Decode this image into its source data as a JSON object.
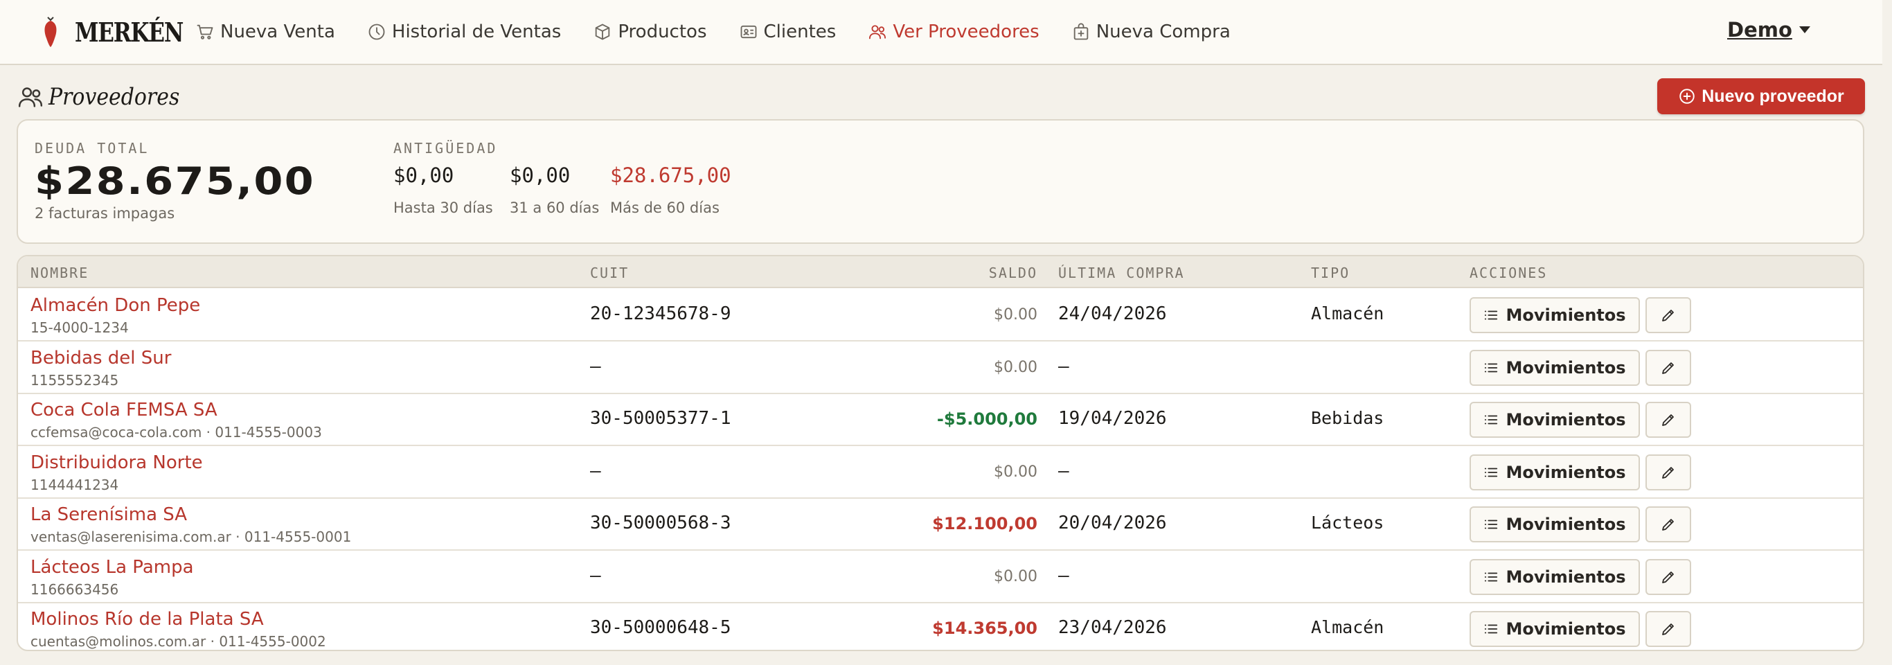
{
  "brand": {
    "name": "MERKÉN"
  },
  "nav": {
    "items": [
      {
        "label": "Nueva Venta",
        "icon": "cart-icon"
      },
      {
        "label": "Historial de Ventas",
        "icon": "clock-icon"
      },
      {
        "label": "Productos",
        "icon": "box-icon"
      },
      {
        "label": "Clientes",
        "icon": "id-card-icon"
      },
      {
        "label": "Ver Proveedores",
        "icon": "users-icon",
        "active": true
      },
      {
        "label": "Nueva Compra",
        "icon": "bag-plus-icon"
      }
    ],
    "user": "Demo"
  },
  "page": {
    "title": "Proveedores",
    "new_button": "Nuevo proveedor"
  },
  "summary": {
    "debt_label": "DEUDA TOTAL",
    "debt_total": "$28.675,00",
    "debt_sub": "2 facturas impagas",
    "age_label": "ANTIGÜEDAD",
    "age": [
      {
        "value": "$0,00",
        "sub": "Hasta 30 días"
      },
      {
        "value": "$0,00",
        "sub": "31 a 60 días"
      },
      {
        "value": "$28.675,00",
        "sub": "Más de 60 días"
      }
    ]
  },
  "table": {
    "headers": {
      "name": "NOMBRE",
      "cuit": "CUIT",
      "saldo": "SALDO",
      "last": "ÚLTIMA COMPRA",
      "tipo": "TIPO",
      "acciones": "ACCIONES"
    },
    "movements_label": "Movimientos",
    "rows": [
      {
        "name": "Almacén Don Pepe",
        "contact": "15-4000-1234",
        "cuit": "20-12345678-9",
        "saldo": "$0.00",
        "saldo_kind": "zero",
        "last": "24/04/2026",
        "tipo": "Almacén"
      },
      {
        "name": "Bebidas del Sur",
        "contact": "1155552345",
        "cuit": "—",
        "saldo": "$0.00",
        "saldo_kind": "zero",
        "last": "—",
        "tipo": ""
      },
      {
        "name": "Coca Cola FEMSA SA",
        "contact": "ccfemsa@coca-cola.com · 011-4555-0003",
        "cuit": "30-50005377-1",
        "saldo": "-$5.000,00",
        "saldo_kind": "neg",
        "last": "19/04/2026",
        "tipo": "Bebidas"
      },
      {
        "name": "Distribuidora Norte",
        "contact": "1144441234",
        "cuit": "—",
        "saldo": "$0.00",
        "saldo_kind": "zero",
        "last": "—",
        "tipo": ""
      },
      {
        "name": "La Serenísima SA",
        "contact": "ventas@laserenisima.com.ar · 011-4555-0001",
        "cuit": "30-50000568-3",
        "saldo": "$12.100,00",
        "saldo_kind": "pos",
        "last": "20/04/2026",
        "tipo": "Lácteos"
      },
      {
        "name": "Lácteos La Pampa",
        "contact": "1166663456",
        "cuit": "—",
        "saldo": "$0.00",
        "saldo_kind": "zero",
        "last": "—",
        "tipo": ""
      },
      {
        "name": "Molinos Río de la Plata SA",
        "contact": "cuentas@molinos.com.ar · 011-4555-0002",
        "cuit": "30-50000648-5",
        "saldo": "$14.365,00",
        "saldo_kind": "pos",
        "last": "23/04/2026",
        "tipo": "Almacén"
      }
    ]
  },
  "colors": {
    "accent": "#c4342a",
    "background": "#f4f1ea",
    "card": "#fcfaf5",
    "positive_balance": "#bf3a30",
    "negative_balance": "#1f7a3c"
  }
}
